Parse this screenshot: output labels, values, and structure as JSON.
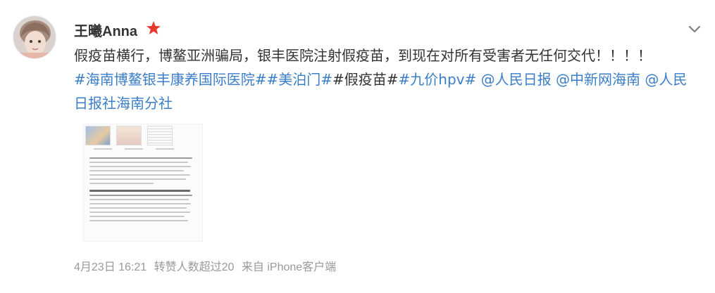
{
  "post": {
    "username": "王曦Anna",
    "text_main": "假疫苗横行，博鳌亚洲骗局，银丰医院注射假疫苗，到现在对所有受害者无任何交代！！！！",
    "tags": [
      "#海南博鳌银丰康养国际医院#",
      "#美泊门#",
      "#假疫苗#",
      "#九价hpv#"
    ],
    "mentions": [
      "@人民日报",
      "@中新网海南",
      "@人民日报社海南分社"
    ],
    "meta": {
      "date": "4月23日 16:21",
      "reposts": "转赞人数超过20",
      "source": "来自 iPhone客户端"
    }
  },
  "colors": {
    "link": "#3a7ec8",
    "badge": "#e8392d",
    "meta": "#999999"
  },
  "icons": {
    "badge": "star-badge-icon",
    "expand": "chevron-down-icon"
  }
}
